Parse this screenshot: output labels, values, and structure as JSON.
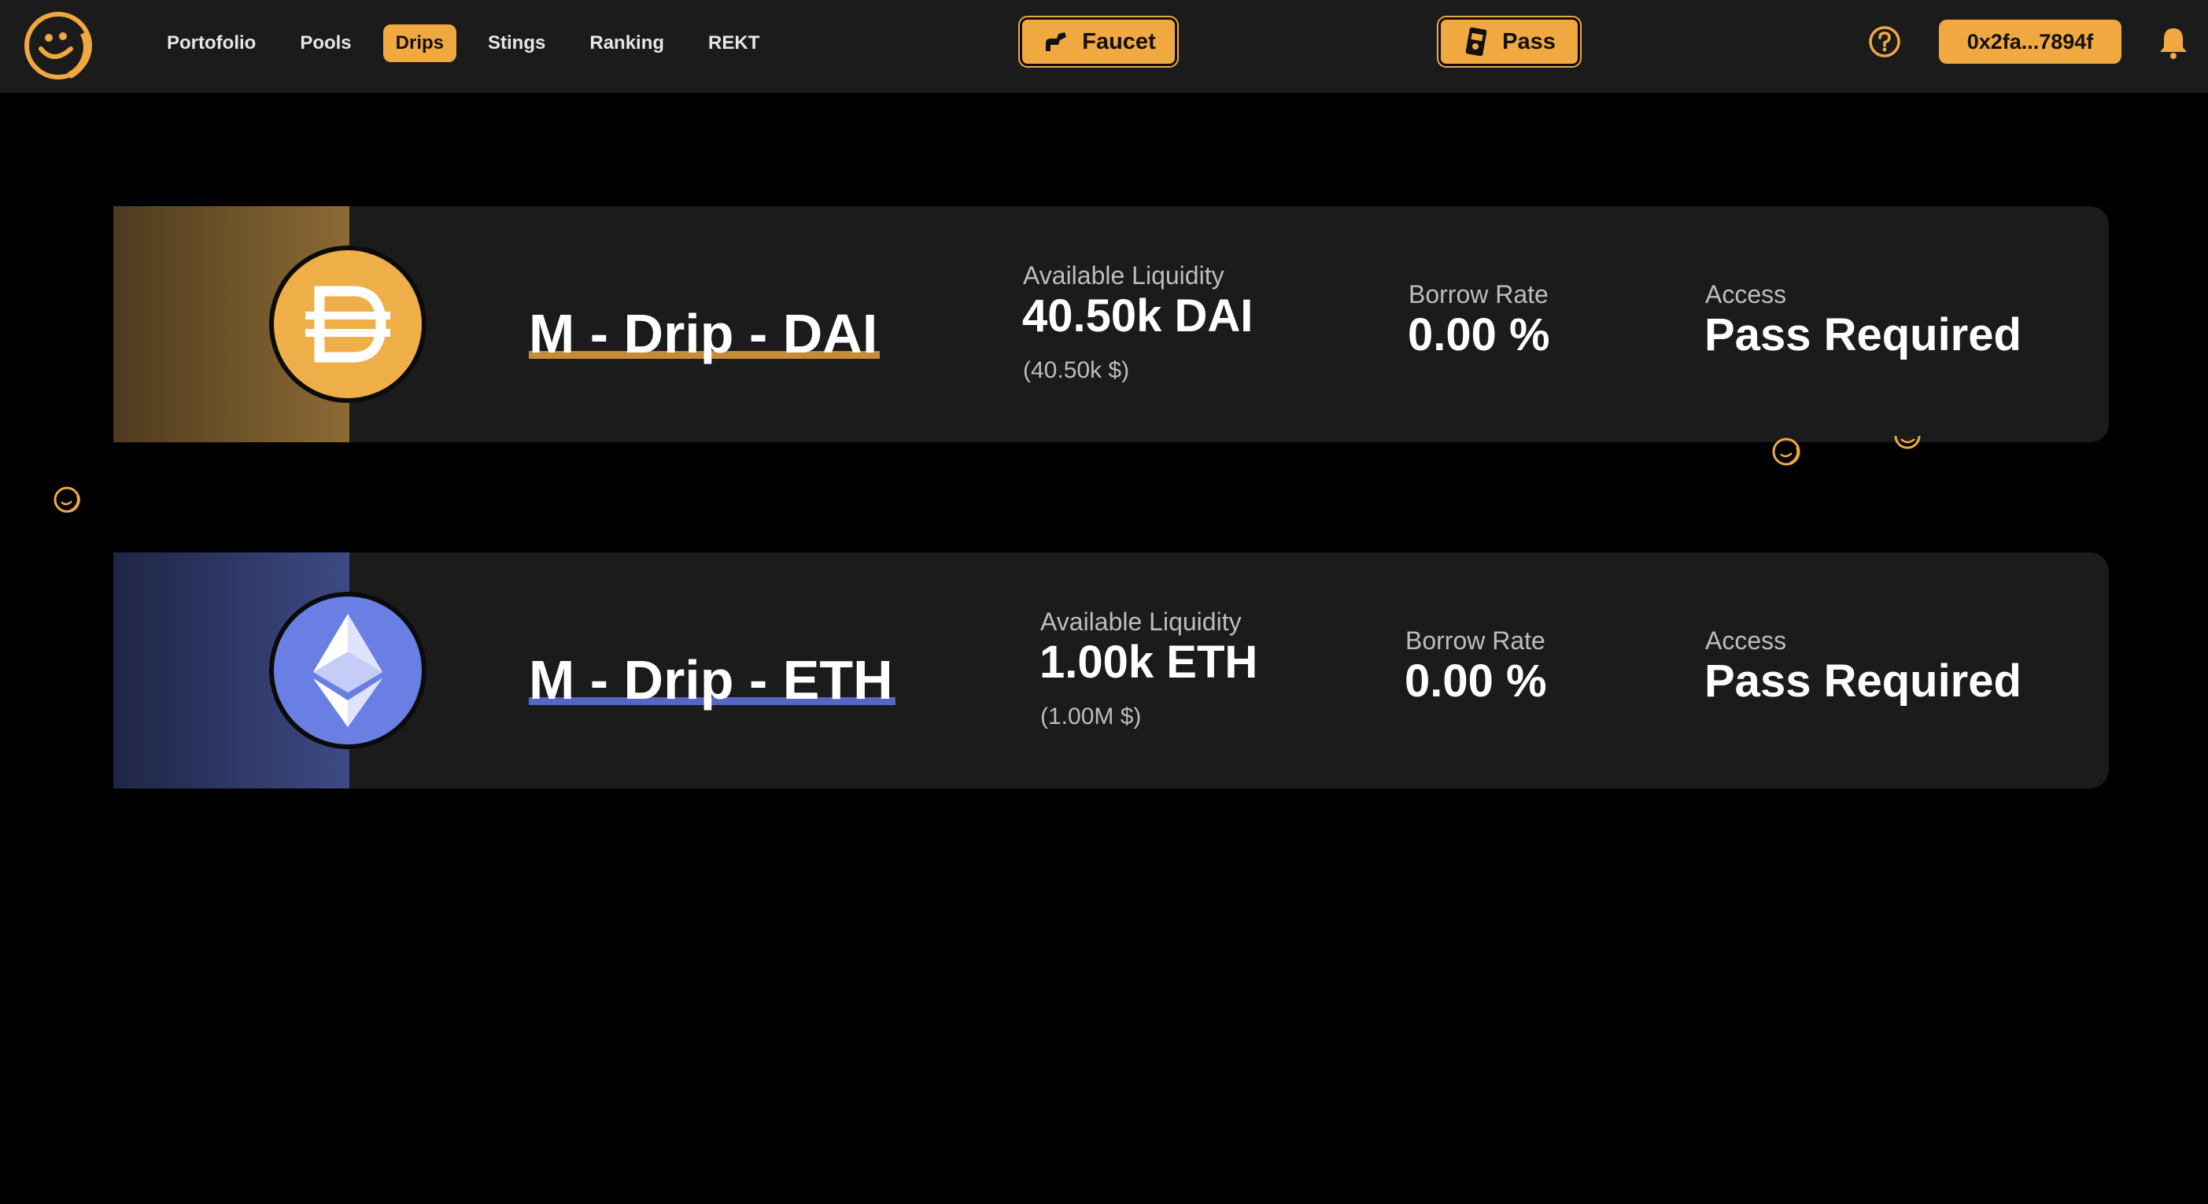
{
  "nav": {
    "items": [
      {
        "label": "Portofolio",
        "active": false
      },
      {
        "label": "Pools",
        "active": false
      },
      {
        "label": "Drips",
        "active": true
      },
      {
        "label": "Stings",
        "active": false
      },
      {
        "label": "Ranking",
        "active": false
      },
      {
        "label": "REKT",
        "active": false
      }
    ]
  },
  "header": {
    "faucet_label": "Faucet",
    "pass_label": "Pass",
    "wallet_address": "0x2fa...7894f"
  },
  "colors": {
    "accent": "#f0a841",
    "background": "#000000",
    "surface": "#1b1b1b",
    "dai": "#efaf48",
    "eth": "#6a7fe4"
  },
  "icons": [
    "logo-smiley-icon",
    "faucet-icon",
    "pass-icon",
    "help-icon",
    "bell-icon",
    "dai-token-icon",
    "eth-token-icon",
    "honey-coin-icon"
  ],
  "drips": [
    {
      "title": "M - Drip - DAI",
      "liquidity_label": "Available Liquidity",
      "liquidity_value": "40.50k DAI",
      "liquidity_usd": "(40.50k $)",
      "borrow_label": "Borrow Rate",
      "borrow_value": "0.00 %",
      "access_label": "Access",
      "access_value": "Pass Required"
    },
    {
      "title": "M - Drip - ETH",
      "liquidity_label": "Available Liquidity",
      "liquidity_value": "1.00k ETH",
      "liquidity_usd": "(1.00M $)",
      "borrow_label": "Borrow Rate",
      "borrow_value": "0.00 %",
      "access_label": "Access",
      "access_value": "Pass Required"
    }
  ]
}
